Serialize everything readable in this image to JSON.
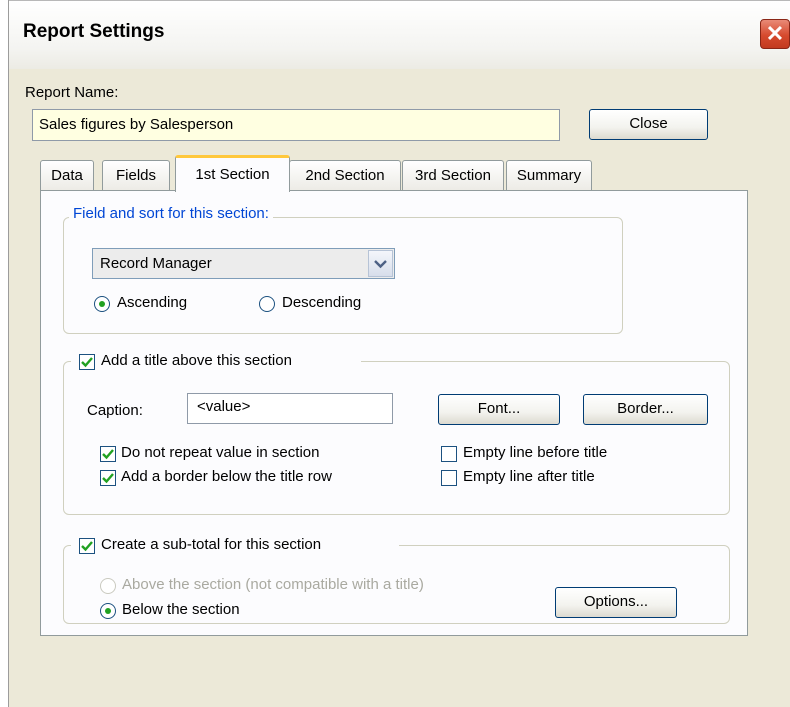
{
  "window": {
    "title": "Report Settings"
  },
  "report": {
    "name_label": "Report Name:",
    "name_value": "Sales figures by Salesperson",
    "close_label": "Close"
  },
  "tabs": [
    {
      "label": "Data"
    },
    {
      "label": "Fields"
    },
    {
      "label": "1st Section"
    },
    {
      "label": "2nd Section"
    },
    {
      "label": "3rd Section"
    },
    {
      "label": "Summary"
    }
  ],
  "active_tab": "1st Section",
  "sort": {
    "legend": "Field and sort for this section:",
    "field_value": "Record Manager",
    "ascending_label": "Ascending",
    "descending_label": "Descending",
    "selected": "Ascending"
  },
  "title_section": {
    "checkbox_label": "Add a title above this section",
    "checked": true,
    "caption_label": "Caption:",
    "caption_value": "<value>",
    "font_button": "Font...",
    "border_button": "Border...",
    "options": [
      {
        "label": "Do not repeat value in section",
        "checked": true
      },
      {
        "label": "Add a border below the title row",
        "checked": true
      },
      {
        "label": "Empty line before title",
        "checked": false
      },
      {
        "label": "Empty line after title",
        "checked": false
      }
    ]
  },
  "subtotal": {
    "checkbox_label": "Create a sub-total for this section",
    "checked": true,
    "above_label": "Above the section (not compatible with a title)",
    "above_enabled": false,
    "below_label": "Below the section",
    "selected": "Below the section",
    "options_button": "Options..."
  },
  "colors": {
    "accent_tab": "#ffc83c",
    "legend_blue": "#0046d5",
    "check_green": "#21a121",
    "name_field_bg": "#ffffe1",
    "close_red": "#d64a2e"
  }
}
